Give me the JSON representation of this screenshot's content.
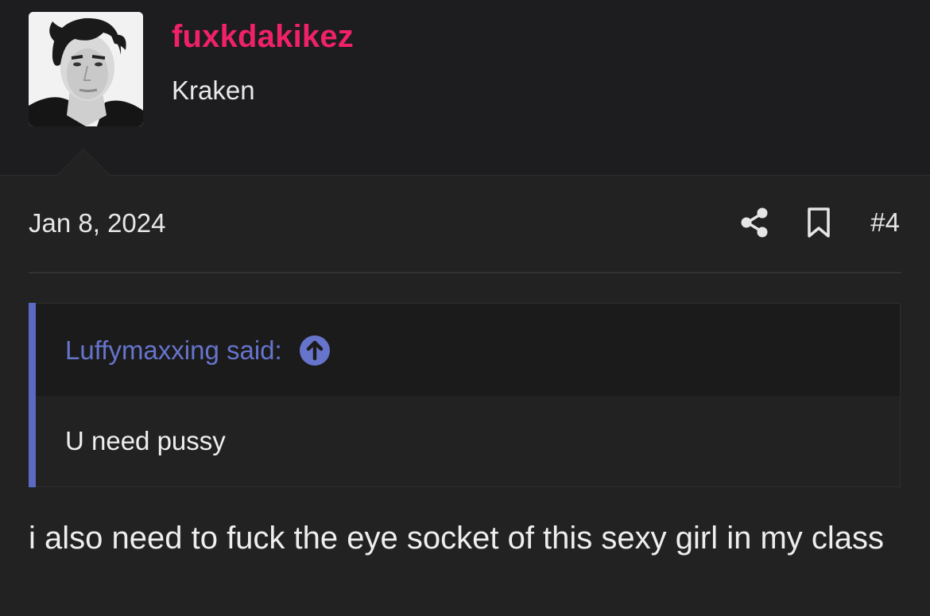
{
  "user": {
    "name": "fuxkdakikez",
    "title": "Kraken",
    "avatar": "portrait-photo"
  },
  "post": {
    "date": "Jan 8, 2024",
    "number": "#4",
    "actions": [
      "share-icon",
      "bookmark-icon"
    ],
    "body": "i also need to fuck the eye socket of this sexy girl in my class"
  },
  "quote": {
    "attribution": "Luffymaxxing said:",
    "jump_icon": "arrow-up-circle-icon",
    "text": "U need pussy"
  },
  "colors": {
    "username": "#ef2167",
    "quote_accent": "#5c6ac4",
    "background": "#222222",
    "header_background": "#1d1c1f"
  }
}
